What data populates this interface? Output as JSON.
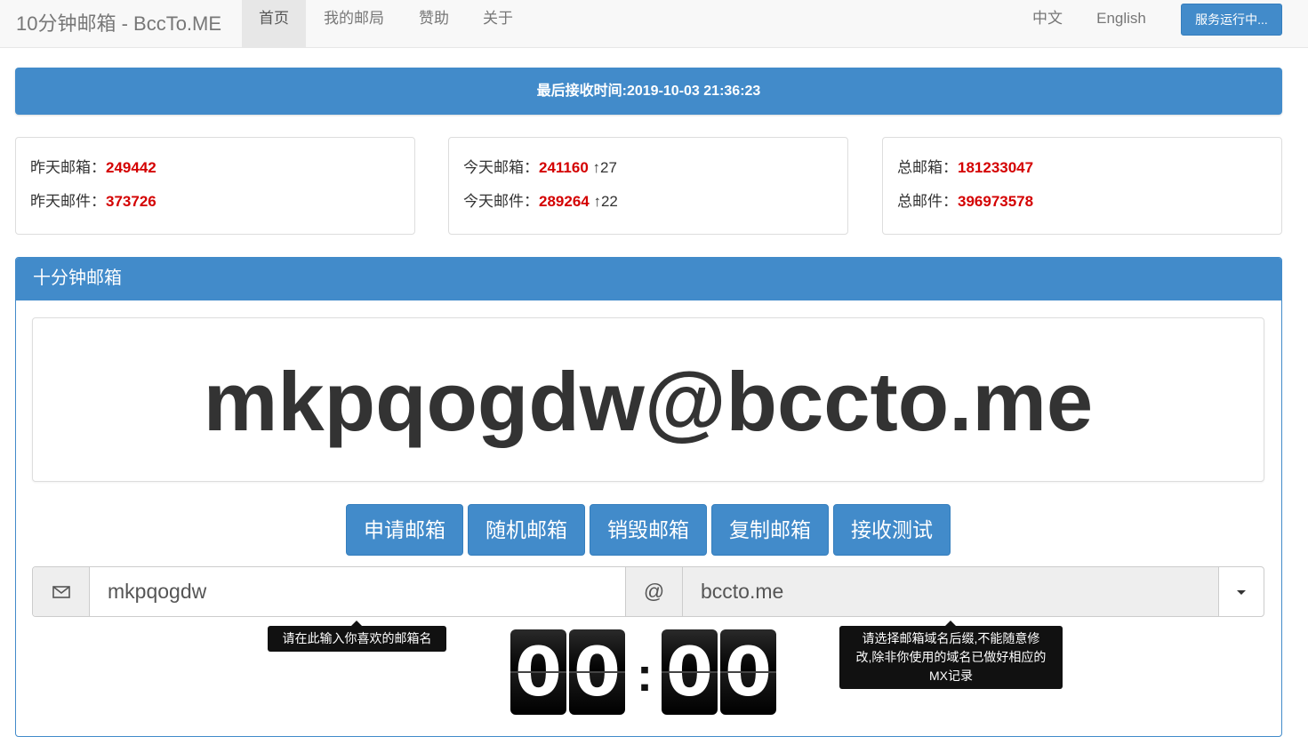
{
  "navbar": {
    "brand": "10分钟邮箱 - BccTo.ME",
    "items": [
      {
        "label": "首页",
        "active": true
      },
      {
        "label": "我的邮局"
      },
      {
        "label": "赞助"
      },
      {
        "label": "关于"
      }
    ],
    "lang_zh": "中文",
    "lang_en": "English",
    "status_button": "服务运行中..."
  },
  "banner": "最后接收时间:2019-10-03 21:36:23",
  "stats": {
    "yesterday_mailbox_label": "昨天邮箱：",
    "yesterday_mailbox_value": "249442",
    "yesterday_mail_label": "昨天邮件：",
    "yesterday_mail_value": "373726",
    "today_mailbox_label": "今天邮箱：",
    "today_mailbox_value": "241160",
    "today_mailbox_delta": "↑27",
    "today_mail_label": "今天邮件：",
    "today_mail_value": "289264",
    "today_mail_delta": "↑22",
    "total_mailbox_label": "总邮箱：",
    "total_mailbox_value": "181233047",
    "total_mail_label": "总邮件：",
    "total_mail_value": "396973578"
  },
  "panel": {
    "title": "十分钟邮箱",
    "email": "mkpqogdw@bccto.me",
    "buttons": [
      "申请邮箱",
      "随机邮箱",
      "销毁邮箱",
      "复制邮箱",
      "接收测试"
    ],
    "username": "mkpqogdw",
    "at": "@",
    "domain": "bccto.me",
    "tooltip_username": "请在此输入你喜欢的邮箱名",
    "tooltip_domain_1": "请选择邮箱域名后缀,不能随意修",
    "tooltip_domain_2": "改,除非你使用的域名已做好相应的",
    "tooltip_domain_3": "MX记录",
    "timer": {
      "m1": "0",
      "m2": "0",
      "s1": "0",
      "s2": "0",
      "sep": ":"
    }
  }
}
